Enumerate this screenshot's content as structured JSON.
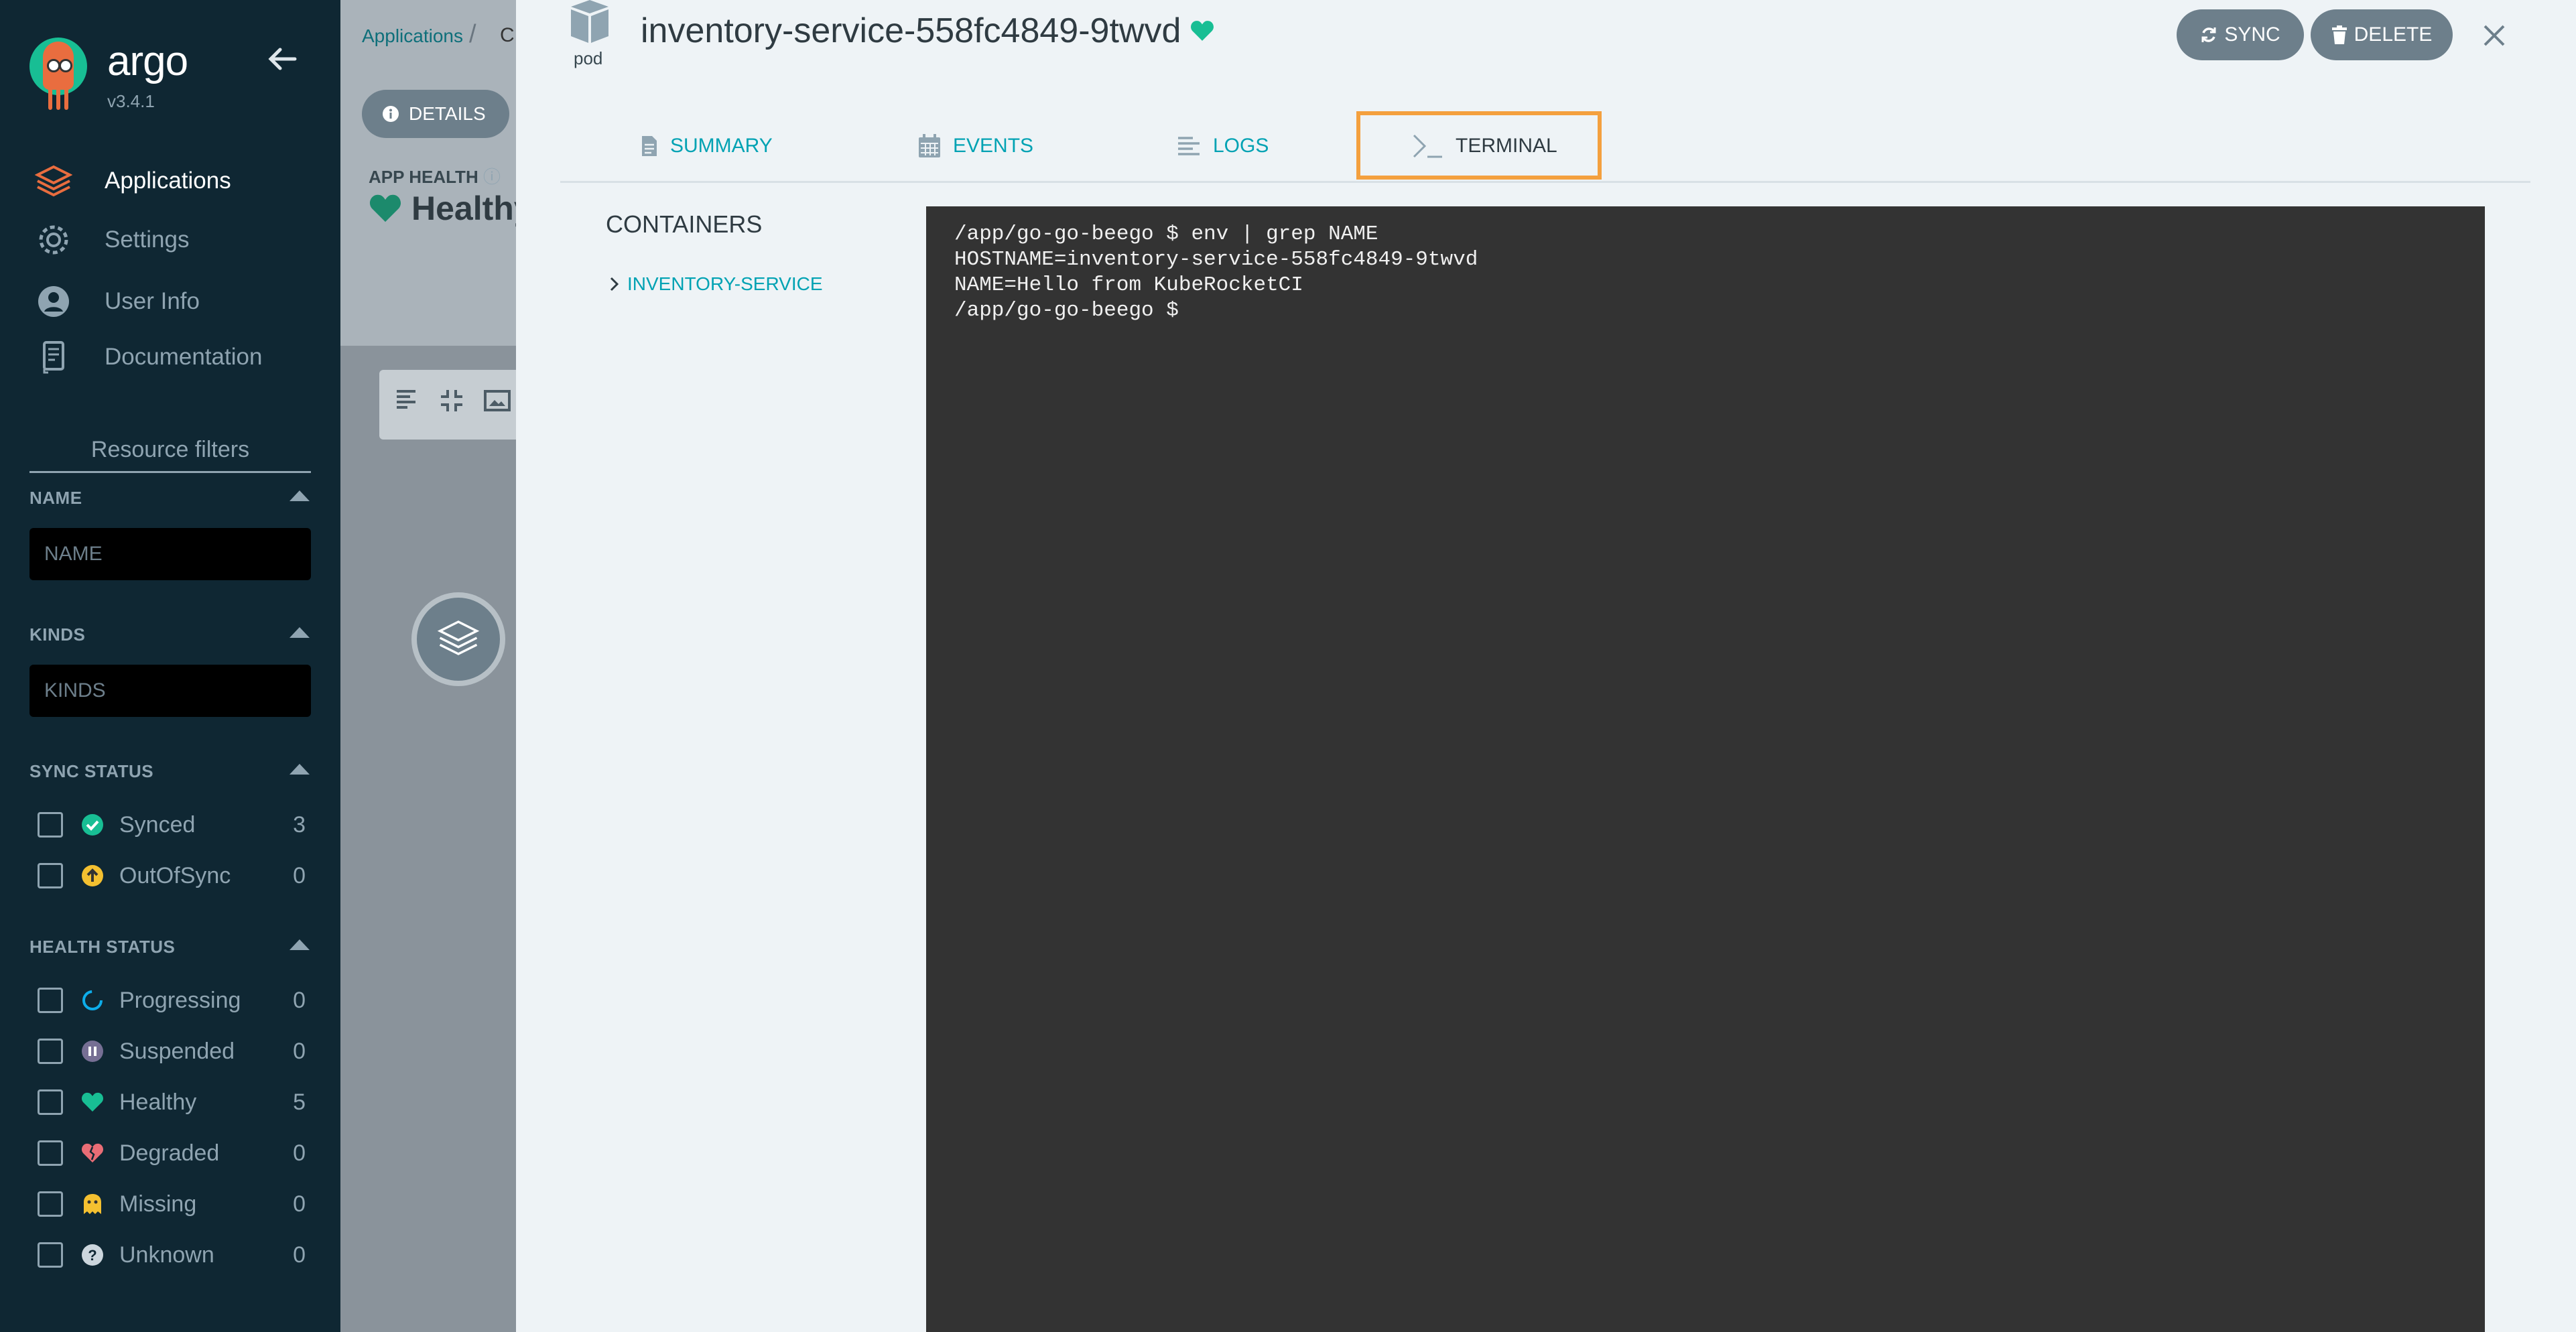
{
  "sidebar": {
    "brand": "argo",
    "version": "v3.4.1",
    "nav": [
      {
        "label": "Applications",
        "icon": "layers-icon",
        "active": true
      },
      {
        "label": "Settings",
        "icon": "gear-icon",
        "active": false
      },
      {
        "label": "User Info",
        "icon": "user-icon",
        "active": false
      },
      {
        "label": "Documentation",
        "icon": "book-icon",
        "active": false
      }
    ],
    "filters_title": "Resource filters",
    "name_label": "NAME",
    "name_placeholder": "NAME",
    "kinds_label": "KINDS",
    "kinds_placeholder": "KINDS",
    "sync_label": "SYNC STATUS",
    "sync_items": [
      {
        "label": "Synced",
        "count": "3",
        "color": "#18be94",
        "icon": "check-circle-icon"
      },
      {
        "label": "OutOfSync",
        "count": "0",
        "color": "#f4c030",
        "icon": "arrow-up-circle-icon"
      }
    ],
    "health_label": "HEALTH STATUS",
    "health_items": [
      {
        "label": "Progressing",
        "count": "0",
        "color": "#0dadea",
        "icon": "progress-ring-icon"
      },
      {
        "label": "Suspended",
        "count": "0",
        "color": "#766f94",
        "icon": "pause-circle-icon"
      },
      {
        "label": "Healthy",
        "count": "5",
        "color": "#18be94",
        "icon": "heart-icon"
      },
      {
        "label": "Degraded",
        "count": "0",
        "color": "#e96d76",
        "icon": "broken-heart-icon"
      },
      {
        "label": "Missing",
        "count": "0",
        "color": "#f4c030",
        "icon": "ghost-icon"
      },
      {
        "label": "Unknown",
        "count": "0",
        "color": "#ccd6dd",
        "icon": "question-circle-icon"
      }
    ]
  },
  "background": {
    "breadcrumb_root": "Applications",
    "breadcrumb_current": "C",
    "details_button": "DETAILS",
    "app_health_label": "APP HEALTH",
    "app_health_value": "Healthy"
  },
  "panel": {
    "kind": "pod",
    "title": "inventory-service-558fc4849-9twvd",
    "sync_button": "SYNC",
    "delete_button": "DELETE",
    "tabs": [
      {
        "label": "SUMMARY",
        "icon": "document-icon"
      },
      {
        "label": "EVENTS",
        "icon": "calendar-icon"
      },
      {
        "label": "LOGS",
        "icon": "lines-icon"
      },
      {
        "label": "TERMINAL",
        "icon": "terminal-prompt-icon"
      }
    ],
    "containers_title": "CONTAINERS",
    "container_name": "INVENTORY-SERVICE",
    "terminal_lines": [
      "/app/go-go-beego $ env | grep NAME",
      "HOSTNAME=inventory-service-558fc4849-9twvd",
      "NAME=Hello from KubeRocketCI",
      "/app/go-go-beego $ "
    ]
  }
}
